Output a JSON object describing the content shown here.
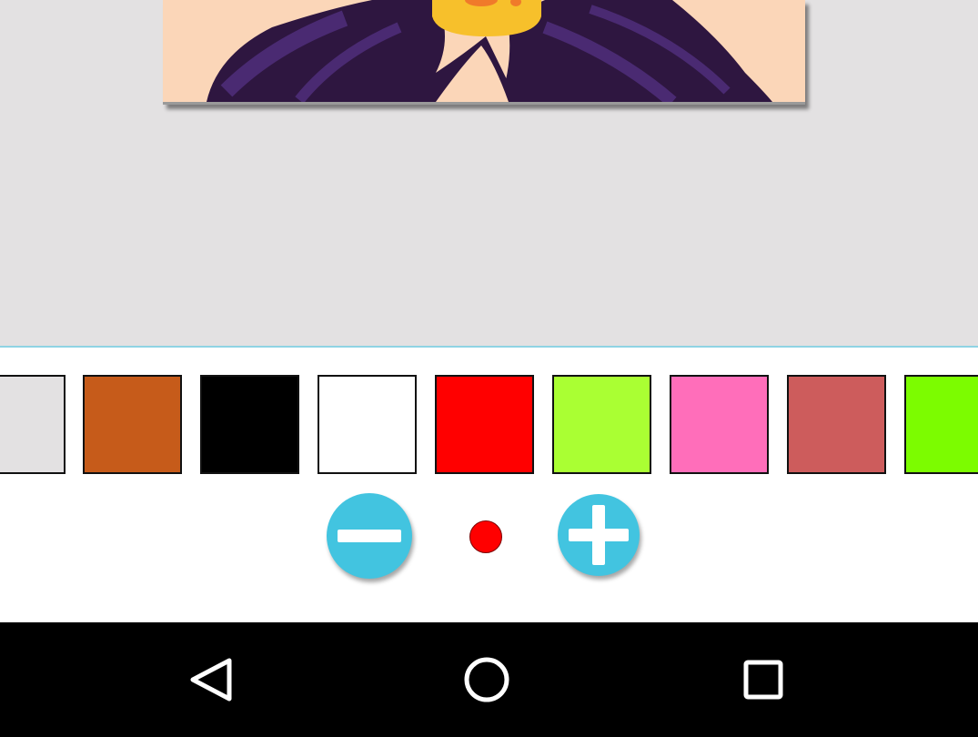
{
  "palette": {
    "colors": [
      "#e3e1e2",
      "#c65b1a",
      "#000000",
      "#ffffff",
      "#ff0000",
      "#aaff33",
      "#ff6eba",
      "#cd5c5c",
      "#7cfc00"
    ],
    "selected_color": "#ff0000"
  },
  "brush": {
    "decrease_icon": "minus-icon",
    "increase_icon": "plus-icon",
    "preview_color": "#ff0000"
  },
  "navigation": {
    "back_icon": "back-triangle-icon",
    "home_icon": "home-circle-icon",
    "recents_icon": "recents-square-icon"
  },
  "theme": {
    "accent": "#42c4e0",
    "canvas_background": "#e3e1e2",
    "panel_background": "#ffffff",
    "nav_background": "#000000",
    "hair_color": "#2e1640",
    "hair_highlight": "#4a2a72",
    "skin_color": "#fbd6b8",
    "crown_color": "#f7c02b"
  }
}
